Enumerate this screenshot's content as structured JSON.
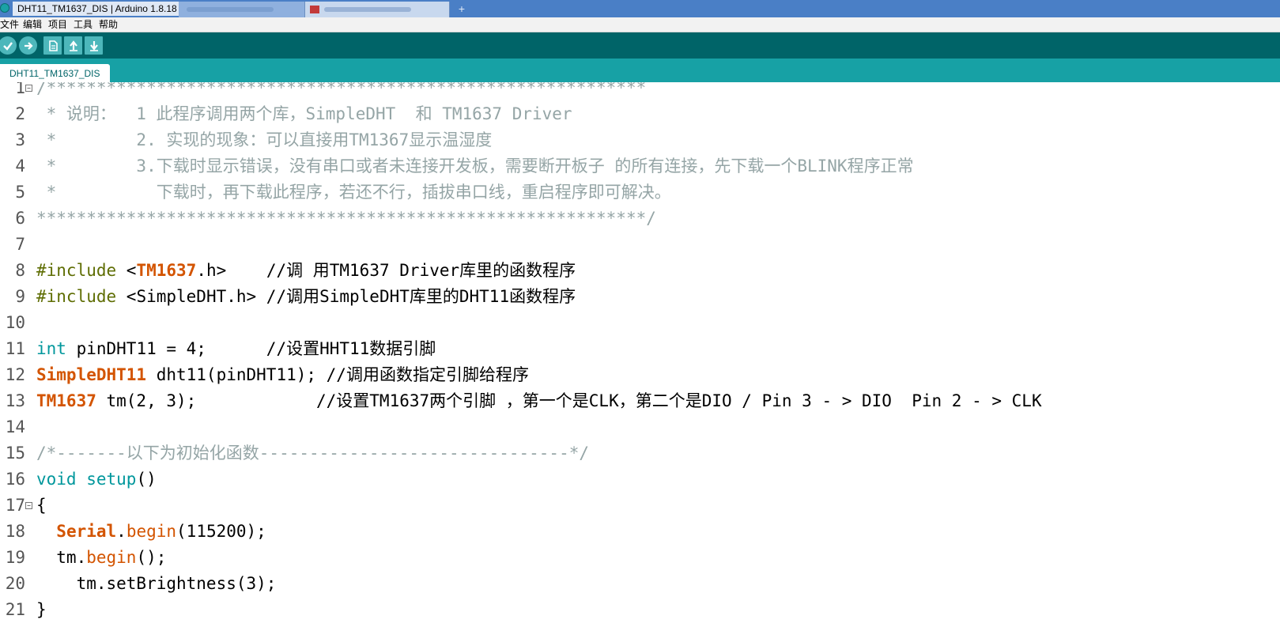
{
  "window": {
    "title": "DHT11_TM1637_DIS | Arduino 1.8.18"
  },
  "menubar": {
    "items": [
      "文件",
      "编辑",
      "项目",
      "工具",
      "帮助"
    ]
  },
  "toolbar": {
    "buttons": [
      {
        "name": "verify",
        "icon": "check-icon"
      },
      {
        "name": "upload",
        "icon": "arrow-right-icon"
      },
      {
        "name": "new",
        "icon": "file-icon"
      },
      {
        "name": "open",
        "icon": "arrow-up-icon"
      },
      {
        "name": "save",
        "icon": "arrow-down-icon"
      }
    ]
  },
  "tabs": [
    {
      "label": "DHT11_TM1637_DIS",
      "active": true
    }
  ],
  "editor": {
    "line_numbers": [
      "1",
      "2",
      "3",
      "4",
      "5",
      "6",
      "7",
      "8",
      "9",
      "10",
      "11",
      "12",
      "13",
      "14",
      "15",
      "16",
      "17",
      "18",
      "19",
      "20",
      "21"
    ],
    "lines": [
      {
        "no": 1,
        "fold": true,
        "parts": [
          {
            "t": "comment",
            "s": "/************************************************************"
          }
        ]
      },
      {
        "no": 2,
        "parts": [
          {
            "t": "comment",
            "s": " * 说明：  1 此程序调用两个库，SimpleDHT  和 TM1637 Driver"
          }
        ]
      },
      {
        "no": 3,
        "parts": [
          {
            "t": "comment",
            "s": " *        2. 实现的现象：可以直接用TM1367显示温湿度"
          }
        ]
      },
      {
        "no": 4,
        "parts": [
          {
            "t": "comment",
            "s": " *        3.下载时显示错误，没有串口或者未连接开发板，需要断开板子 的所有连接，先下载一个BLINK程序正常"
          }
        ]
      },
      {
        "no": 5,
        "parts": [
          {
            "t": "comment",
            "s": " *          下载时，再下载此程序，若还不行，插拔串口线，重启程序即可解决。"
          }
        ]
      },
      {
        "no": 6,
        "parts": [
          {
            "t": "comment",
            "s": "*************************************************************/"
          }
        ]
      },
      {
        "no": 7,
        "parts": []
      },
      {
        "no": 8,
        "parts": [
          {
            "t": "dir",
            "s": "#include"
          },
          {
            "t": "text",
            "s": " <"
          },
          {
            "t": "lib",
            "s": "TM1637"
          },
          {
            "t": "text",
            "s": ".h>    "
          },
          {
            "t": "text",
            "s": "//调 用TM1637 Driver库里的函数程序"
          }
        ]
      },
      {
        "no": 9,
        "parts": [
          {
            "t": "dir",
            "s": "#include"
          },
          {
            "t": "text",
            "s": " <SimpleDHT.h> //调用SimpleDHT库里的DHT11函数程序"
          }
        ]
      },
      {
        "no": 10,
        "parts": []
      },
      {
        "no": 11,
        "parts": [
          {
            "t": "kw",
            "s": "int"
          },
          {
            "t": "text",
            "s": " pinDHT11 = 4;      //设置HHT11数据引脚"
          }
        ]
      },
      {
        "no": 12,
        "parts": [
          {
            "t": "type",
            "s": "SimpleDHT11"
          },
          {
            "t": "text",
            "s": " dht11(pinDHT11); //调用函数指定引脚给程序"
          }
        ]
      },
      {
        "no": 13,
        "parts": [
          {
            "t": "type",
            "s": "TM1637"
          },
          {
            "t": "text",
            "s": " tm(2, 3);            //设置TM1637两个引脚 ，第一个是CLK，第二个是DIO / Pin 3 - > DIO  Pin 2 - > CLK"
          }
        ]
      },
      {
        "no": 14,
        "parts": []
      },
      {
        "no": 15,
        "parts": [
          {
            "t": "comment",
            "s": "/*-------以下为初始化函数-------------------------------*/"
          }
        ]
      },
      {
        "no": 16,
        "parts": [
          {
            "t": "kw",
            "s": "void"
          },
          {
            "t": "text",
            "s": " "
          },
          {
            "t": "kw",
            "s": "setup"
          },
          {
            "t": "text",
            "s": "()"
          }
        ]
      },
      {
        "no": 17,
        "fold": true,
        "parts": [
          {
            "t": "text",
            "s": "{"
          }
        ]
      },
      {
        "no": 18,
        "parts": [
          {
            "t": "text",
            "s": "  "
          },
          {
            "t": "type",
            "s": "Serial"
          },
          {
            "t": "text",
            "s": "."
          },
          {
            "t": "func",
            "s": "begin"
          },
          {
            "t": "text",
            "s": "(115200);"
          }
        ]
      },
      {
        "no": 19,
        "parts": [
          {
            "t": "text",
            "s": "  tm."
          },
          {
            "t": "func",
            "s": "begin"
          },
          {
            "t": "text",
            "s": "();"
          }
        ]
      },
      {
        "no": 20,
        "parts": [
          {
            "t": "text",
            "s": "    tm.setBrightness(3);"
          }
        ]
      },
      {
        "no": 21,
        "parts": [
          {
            "t": "text",
            "s": "}"
          }
        ]
      }
    ]
  }
}
